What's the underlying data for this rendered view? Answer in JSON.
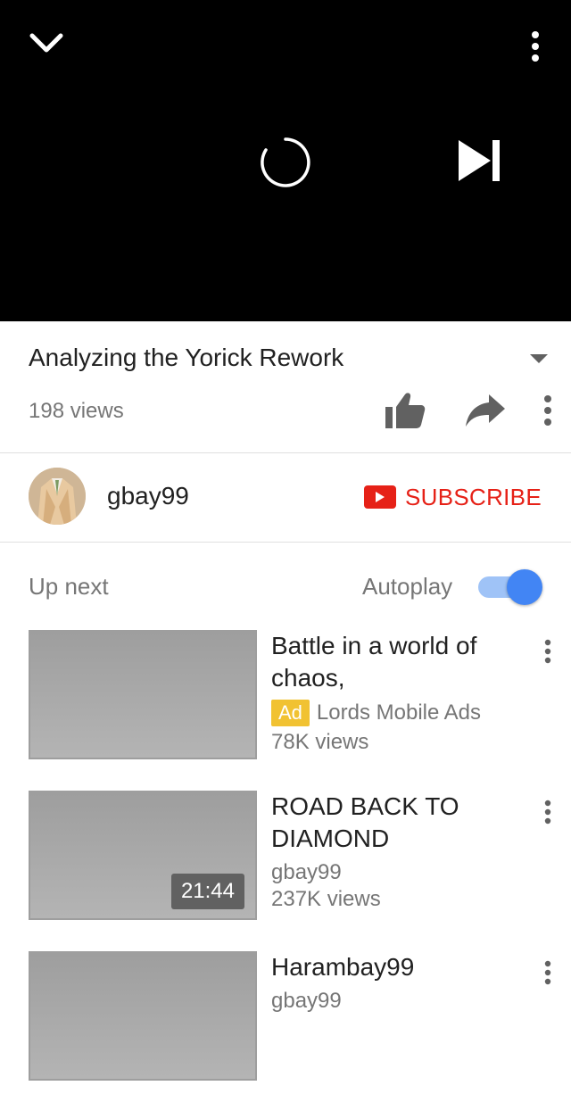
{
  "player": {
    "collapse_icon": "chevron-down-icon",
    "more_icon": "vertical-dots-icon",
    "loading_icon": "loading-spinner-icon",
    "next_icon": "skip-next-icon"
  },
  "video": {
    "title": "Analyzing the Yorick Rework",
    "views": "198 views",
    "expand_icon": "caret-down-icon",
    "like_icon": "thumbs-up-icon",
    "share_icon": "share-arrow-icon",
    "more_icon": "vertical-dots-icon"
  },
  "channel": {
    "name": "gbay99",
    "avatar_icon": "avatar",
    "subscribe_label": "SUBSCRIBE",
    "subscribe_icon": "youtube-play-icon"
  },
  "up_next": {
    "label": "Up next",
    "autoplay_label": "Autoplay",
    "autoplay_on": true
  },
  "items": [
    {
      "title": "Battle in a world of chaos,",
      "ad_badge": "Ad",
      "channel": "Lords Mobile Ads",
      "views": "78K views",
      "duration": ""
    },
    {
      "title": "ROAD BACK TO DIAMOND",
      "ad_badge": "",
      "channel": "gbay99",
      "views": "237K views",
      "duration": "21:44"
    },
    {
      "title": "Harambay99",
      "ad_badge": "",
      "channel": "gbay99",
      "views": "",
      "duration": ""
    }
  ],
  "colors": {
    "player_bg": "#000000",
    "subscribe": "#e62117",
    "toggle_accent": "#4285f4",
    "ad_badge": "#f1c232",
    "text_primary": "#212121",
    "text_secondary": "#767676"
  }
}
